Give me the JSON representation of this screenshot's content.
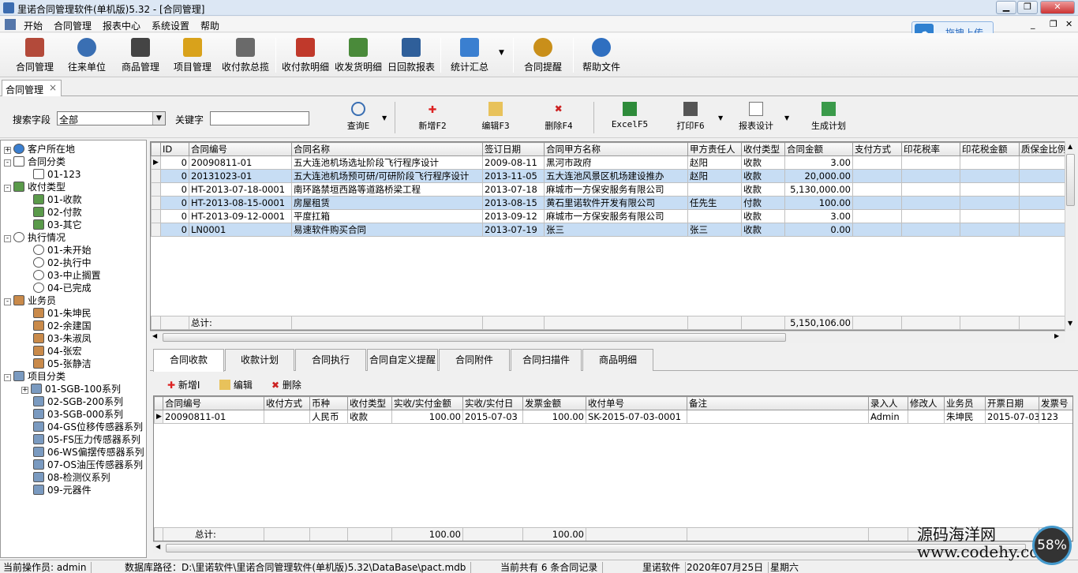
{
  "app": {
    "title": "里诺合同管理软件(单机版)5.32 - [合同管理]"
  },
  "menu": [
    "开始",
    "合同管理",
    "报表中心",
    "系统设置",
    "帮助"
  ],
  "upload_button": "拖拽上传",
  "toolbar": [
    {
      "label": "合同管理",
      "icon": "contract-icon"
    },
    {
      "label": "往来单位",
      "icon": "partner-icon"
    },
    {
      "label": "商品管理",
      "icon": "goods-icon"
    },
    {
      "label": "项目管理",
      "icon": "project-icon"
    },
    {
      "label": "收付款总揽",
      "icon": "payment-overview-icon"
    },
    {
      "label": "收付款明细",
      "icon": "payment-detail-icon"
    },
    {
      "label": "收发货明细",
      "icon": "shipping-detail-icon"
    },
    {
      "label": "日回款报表",
      "icon": "daily-report-icon"
    },
    {
      "label": "统计汇总",
      "icon": "statistics-icon"
    },
    {
      "label": "合同提醒",
      "icon": "reminder-icon"
    },
    {
      "label": "帮助文件",
      "icon": "help-icon"
    }
  ],
  "doc_tab": {
    "label": "合同管理",
    "close": "×"
  },
  "search": {
    "field_label": "搜索字段",
    "field_value": "全部",
    "keyword_label": "关键字",
    "keyword_value": "",
    "buttons": {
      "query": "查询E",
      "add": "新增F2",
      "edit": "编辑F3",
      "delete": "删除F4",
      "excel": "ExcelF5",
      "print": "打印F6",
      "report_design": "报表设计",
      "gen_plan": "生成计划"
    }
  },
  "tree": [
    {
      "label": "客户所在地",
      "level": 0,
      "exp": "+",
      "icon": "globe-icon"
    },
    {
      "label": "合同分类",
      "level": 0,
      "exp": "-",
      "icon": "document-icon"
    },
    {
      "label": "01-123",
      "level": 1,
      "icon": "document-icon"
    },
    {
      "label": "收付类型",
      "level": 0,
      "exp": "-",
      "icon": "money-icon"
    },
    {
      "label": "01-收款",
      "level": 1,
      "icon": "money-icon"
    },
    {
      "label": "02-付款",
      "level": 1,
      "icon": "money-icon"
    },
    {
      "label": "03-其它",
      "level": 1,
      "icon": "money-icon"
    },
    {
      "label": "执行情况",
      "level": 0,
      "exp": "-",
      "icon": "clock-icon"
    },
    {
      "label": "01-未开始",
      "level": 1,
      "icon": "clock-icon"
    },
    {
      "label": "02-执行中",
      "level": 1,
      "icon": "clock-icon"
    },
    {
      "label": "03-中止搁置",
      "level": 1,
      "icon": "clock-icon"
    },
    {
      "label": "04-已完成",
      "level": 1,
      "icon": "clock-icon"
    },
    {
      "label": "业务员",
      "level": 0,
      "exp": "-",
      "icon": "person-icon"
    },
    {
      "label": "01-朱坤民",
      "level": 1,
      "icon": "person-icon"
    },
    {
      "label": "02-余建国",
      "level": 1,
      "icon": "person-icon"
    },
    {
      "label": "03-朱淑凤",
      "level": 1,
      "icon": "person-icon"
    },
    {
      "label": "04-张宏",
      "level": 1,
      "icon": "person-icon"
    },
    {
      "label": "05-张静洁",
      "level": 1,
      "icon": "person-icon"
    },
    {
      "label": "项目分类",
      "level": 0,
      "exp": "-",
      "icon": "folder-icon"
    },
    {
      "label": "01-SGB-100系列",
      "level": 1,
      "exp": "+",
      "icon": "folder-icon"
    },
    {
      "label": "02-SGB-200系列",
      "level": 1,
      "icon": "folder-icon"
    },
    {
      "label": "03-SGB-000系列",
      "level": 1,
      "icon": "folder-icon"
    },
    {
      "label": "04-GS位移传感器系列",
      "level": 1,
      "icon": "folder-icon"
    },
    {
      "label": "05-FS压力传感器系列",
      "level": 1,
      "icon": "folder-icon"
    },
    {
      "label": "06-WS偏摆传感器系列",
      "level": 1,
      "icon": "folder-icon"
    },
    {
      "label": "07-OS油压传感器系列",
      "level": 1,
      "icon": "folder-icon"
    },
    {
      "label": "08-检测仪系列",
      "level": 1,
      "icon": "folder-icon"
    },
    {
      "label": "09-元器件",
      "level": 1,
      "icon": "folder-icon"
    }
  ],
  "grid1": {
    "columns": [
      "ID",
      "合同编号",
      "合同名称",
      "签订日期",
      "合同甲方名称",
      "甲方责任人",
      "收付类型",
      "合同金额",
      "支付方式",
      "印花税率",
      "印花税金额",
      "质保金比例"
    ],
    "rows": [
      [
        "0",
        "20090811-01",
        "五大连池机场选址阶段飞行程序设计",
        "2009-08-11",
        "黑河市政府",
        "赵阳",
        "收款",
        "3.00",
        "",
        "",
        "",
        ""
      ],
      [
        "0",
        "20131023-01",
        "五大连池机场预可研/可研阶段飞行程序设计",
        "2013-11-05",
        "五大连池风景区机场建设推办",
        "赵阳",
        "收款",
        "20,000.00",
        "",
        "",
        "",
        ""
      ],
      [
        "0",
        "HT-2013-07-18-0001",
        "南环路禁垣西路等道路桥梁工程",
        "2013-07-18",
        "麻城市一方保安服务有限公司",
        "",
        "收款",
        "5,130,000.00",
        "",
        "",
        "",
        ""
      ],
      [
        "0",
        "HT-2013-08-15-0001",
        "房屋租赁",
        "2013-08-15",
        "黄石里诺软件开发有限公司",
        "任先生",
        "付款",
        "100.00",
        "",
        "",
        "",
        ""
      ],
      [
        "0",
        "HT-2013-09-12-0001",
        "平度扛箱",
        "2013-09-12",
        "麻城市一方保安服务有限公司",
        "",
        "收款",
        "3.00",
        "",
        "",
        "",
        ""
      ],
      [
        "0",
        "LN0001",
        "易速软件购买合同",
        "2013-07-19",
        "张三",
        "张三",
        "收款",
        "0.00",
        "",
        "",
        "",
        ""
      ]
    ],
    "total_label": "总计:",
    "total_amount": "5,150,106.00"
  },
  "subtabs": [
    "合同收款",
    "收款计划",
    "合同执行",
    "合同自定义提醒",
    "合同附件",
    "合同扫描件",
    "商品明细"
  ],
  "subtool": {
    "add": "新增I",
    "edit": "编辑",
    "delete": "删除"
  },
  "grid2": {
    "columns": [
      "合同编号",
      "收付方式",
      "币种",
      "收付类型",
      "实收/实付金额",
      "实收/实付日",
      "发票金额",
      "收付单号",
      "备注",
      "录入人",
      "修改人",
      "业务员",
      "开票日期",
      "发票号"
    ],
    "rows": [
      [
        "20090811-01",
        "",
        "人民币",
        "收款",
        "100.00",
        "2015-07-03",
        "100.00",
        "SK-2015-07-03-0001",
        "",
        "Admin",
        "",
        "朱坤民",
        "2015-07-03",
        "123"
      ]
    ],
    "total_label": "总计:",
    "total_amount": "100.00",
    "total_invoice": "100.00"
  },
  "status": {
    "operator": "当前操作员: admin",
    "db_path": "数据库路径：D:\\里诺软件\\里诺合同管理软件(单机版)5.32\\DataBase\\pact.mdb",
    "count": "当前共有 6 条合同记录",
    "brand": "里诺软件",
    "date": "2020年07月25日",
    "weekday": "星期六"
  },
  "watermark": {
    "line1": "源码海洋网",
    "line2": "www.codehy.com"
  },
  "gauge": "58%"
}
